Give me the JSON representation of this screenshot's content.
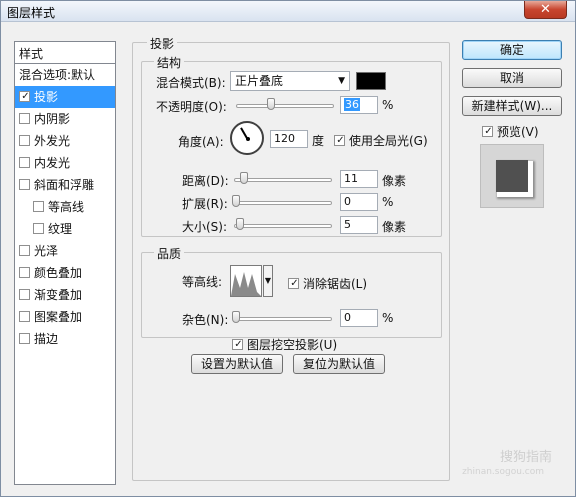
{
  "window": {
    "title": "图层样式",
    "close_icon": "close-icon"
  },
  "styles_list": {
    "header": "样式",
    "items": [
      {
        "label": "混合选项:默认",
        "checkbox": false,
        "checked": false,
        "indent": false,
        "selected": false
      },
      {
        "label": "投影",
        "checkbox": true,
        "checked": true,
        "indent": false,
        "selected": true
      },
      {
        "label": "内阴影",
        "checkbox": true,
        "checked": false,
        "indent": false,
        "selected": false
      },
      {
        "label": "外发光",
        "checkbox": true,
        "checked": false,
        "indent": false,
        "selected": false
      },
      {
        "label": "内发光",
        "checkbox": true,
        "checked": false,
        "indent": false,
        "selected": false
      },
      {
        "label": "斜面和浮雕",
        "checkbox": true,
        "checked": false,
        "indent": false,
        "selected": false
      },
      {
        "label": "等高线",
        "checkbox": true,
        "checked": false,
        "indent": true,
        "selected": false
      },
      {
        "label": "纹理",
        "checkbox": true,
        "checked": false,
        "indent": true,
        "selected": false
      },
      {
        "label": "光泽",
        "checkbox": true,
        "checked": false,
        "indent": false,
        "selected": false
      },
      {
        "label": "颜色叠加",
        "checkbox": true,
        "checked": false,
        "indent": false,
        "selected": false
      },
      {
        "label": "渐变叠加",
        "checkbox": true,
        "checked": false,
        "indent": false,
        "selected": false
      },
      {
        "label": "图案叠加",
        "checkbox": true,
        "checked": false,
        "indent": false,
        "selected": false
      },
      {
        "label": "描边",
        "checkbox": true,
        "checked": false,
        "indent": false,
        "selected": false
      }
    ]
  },
  "drop_shadow": {
    "section_title": "投影",
    "structure": {
      "title": "结构",
      "blend_mode_label": "混合模式(B):",
      "blend_mode_value": "正片叠底",
      "shadow_color": "#000000",
      "opacity_label": "不透明度(O):",
      "opacity_value": "36",
      "opacity_fraction": 0.36,
      "percent": "%",
      "angle_label": "角度(A):",
      "angle_value": "120",
      "degree_unit": "度",
      "global_light_label": "使用全局光(G)",
      "global_light_checked": true,
      "distance_label": "距离(D):",
      "distance_value": "11",
      "spread_label": "扩展(R):",
      "spread_value": "0",
      "size_label": "大小(S):",
      "size_value": "5",
      "pixel_unit": "像素"
    },
    "quality": {
      "title": "品质",
      "contour_label": "等高线:",
      "anti_alias_label": "消除锯齿(L)",
      "anti_alias_checked": true,
      "noise_label": "杂色(N):",
      "noise_value": "0",
      "percent": "%"
    },
    "knockout_label": "图层挖空投影(U)",
    "knockout_checked": true,
    "make_default_label": "设置为默认值",
    "reset_default_label": "复位为默认值"
  },
  "right_panel": {
    "ok_label": "确定",
    "cancel_label": "取消",
    "new_style_label": "新建样式(W)...",
    "preview_label": "预览(V)",
    "preview_checked": true
  },
  "watermark": {
    "text": "搜狗指南",
    "url": "zhinan.sogou.com"
  }
}
